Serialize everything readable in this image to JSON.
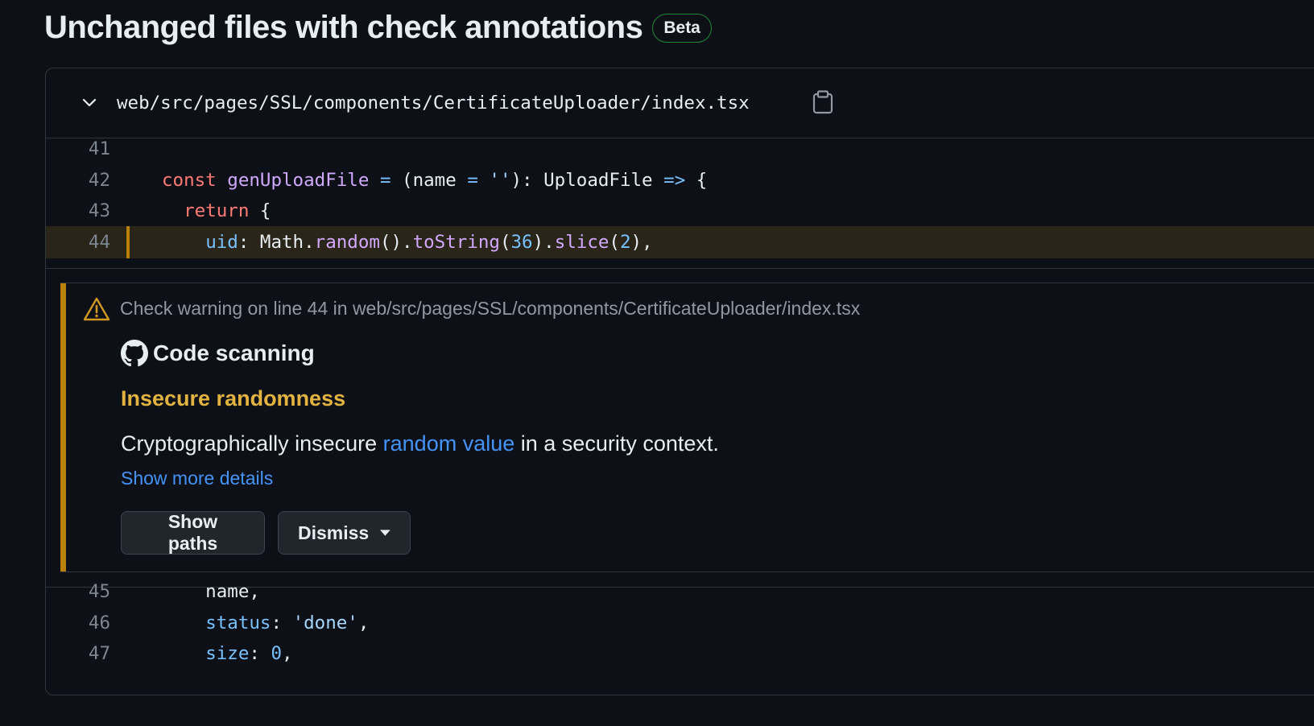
{
  "heading": {
    "title": "Unchanged files with check annotations",
    "badge": "Beta"
  },
  "file": {
    "path": "web/src/pages/SSL/components/CertificateUploader/index.tsx"
  },
  "code_before": [
    {
      "num": "41",
      "tokens": []
    },
    {
      "num": "42",
      "tokens": [
        {
          "t": "const",
          "c": "kw"
        },
        {
          "t": " ",
          "c": ""
        },
        {
          "t": "genUploadFile",
          "c": "fn"
        },
        {
          "t": " ",
          "c": ""
        },
        {
          "t": "=",
          "c": "op"
        },
        {
          "t": " (name ",
          "c": ""
        },
        {
          "t": "=",
          "c": "op"
        },
        {
          "t": " ",
          "c": ""
        },
        {
          "t": "''",
          "c": "str"
        },
        {
          "t": "): UploadFile ",
          "c": ""
        },
        {
          "t": "=>",
          "c": "op"
        },
        {
          "t": " {",
          "c": ""
        }
      ]
    },
    {
      "num": "43",
      "tokens": [
        {
          "t": "  ",
          "c": ""
        },
        {
          "t": "return",
          "c": "kw"
        },
        {
          "t": " {",
          "c": ""
        }
      ]
    },
    {
      "num": "44",
      "highlight": true,
      "tokens": [
        {
          "t": "    ",
          "c": ""
        },
        {
          "t": "uid",
          "c": "prop"
        },
        {
          "t": ": Math.",
          "c": ""
        },
        {
          "t": "random",
          "c": "fn"
        },
        {
          "t": "().",
          "c": ""
        },
        {
          "t": "toString",
          "c": "fn"
        },
        {
          "t": "(",
          "c": ""
        },
        {
          "t": "36",
          "c": "num"
        },
        {
          "t": ").",
          "c": ""
        },
        {
          "t": "slice",
          "c": "fn"
        },
        {
          "t": "(",
          "c": ""
        },
        {
          "t": "2",
          "c": "num"
        },
        {
          "t": "),",
          "c": ""
        }
      ]
    }
  ],
  "annotation": {
    "warning": "Check warning on line 44 in web/src/pages/SSL/components/CertificateUploader/index.tsx",
    "tool": "Code scanning",
    "rule": "Insecure randomness",
    "desc_before": "Cryptographically insecure ",
    "desc_link": "random value",
    "desc_after": " in a security context.",
    "more": "Show more details",
    "btn_paths": "Show paths",
    "btn_dismiss": "Dismiss",
    "accent_color": "#bb8009"
  },
  "code_after": [
    {
      "num": "45",
      "tokens": [
        {
          "t": "    name,",
          "c": ""
        }
      ]
    },
    {
      "num": "46",
      "tokens": [
        {
          "t": "    ",
          "c": ""
        },
        {
          "t": "status",
          "c": "prop"
        },
        {
          "t": ": ",
          "c": ""
        },
        {
          "t": "'done'",
          "c": "str"
        },
        {
          "t": ",",
          "c": ""
        }
      ]
    },
    {
      "num": "47",
      "tokens": [
        {
          "t": "    ",
          "c": ""
        },
        {
          "t": "size",
          "c": "prop"
        },
        {
          "t": ": ",
          "c": ""
        },
        {
          "t": "0",
          "c": "num"
        },
        {
          "t": ",",
          "c": ""
        }
      ]
    }
  ]
}
